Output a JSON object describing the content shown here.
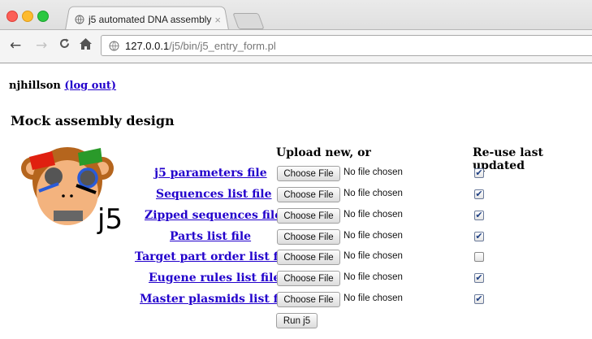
{
  "browser": {
    "tab_title": "j5 automated DNA assembly",
    "tab_close": "×",
    "url_host": "127.0.0.1",
    "url_path": "/j5/bin/j5_entry_form.pl"
  },
  "page": {
    "username": "njhillson",
    "logout_label": "(log out)",
    "title": "Mock assembly design",
    "logo_text": "j5",
    "header_upload": "Upload new, or",
    "header_reuse": "Re-use last updated",
    "choose_label": "Choose File",
    "no_file_label": "No file chosen",
    "run_label": "Run j5",
    "rows": [
      {
        "label": "j5 parameters file",
        "checked": true
      },
      {
        "label": "Sequences list file",
        "checked": true
      },
      {
        "label": "Zipped sequences file",
        "checked": true
      },
      {
        "label": "Parts list file",
        "checked": true
      },
      {
        "label": "Target part order list file",
        "checked": false
      },
      {
        "label": "Eugene rules list file",
        "checked": true
      },
      {
        "label": "Master plasmids list file",
        "checked": true
      }
    ]
  },
  "icons": {
    "back": "arrow-left-icon",
    "forward": "arrow-right-icon",
    "reload": "reload-icon",
    "home": "home-icon",
    "globe": "globe-icon"
  }
}
